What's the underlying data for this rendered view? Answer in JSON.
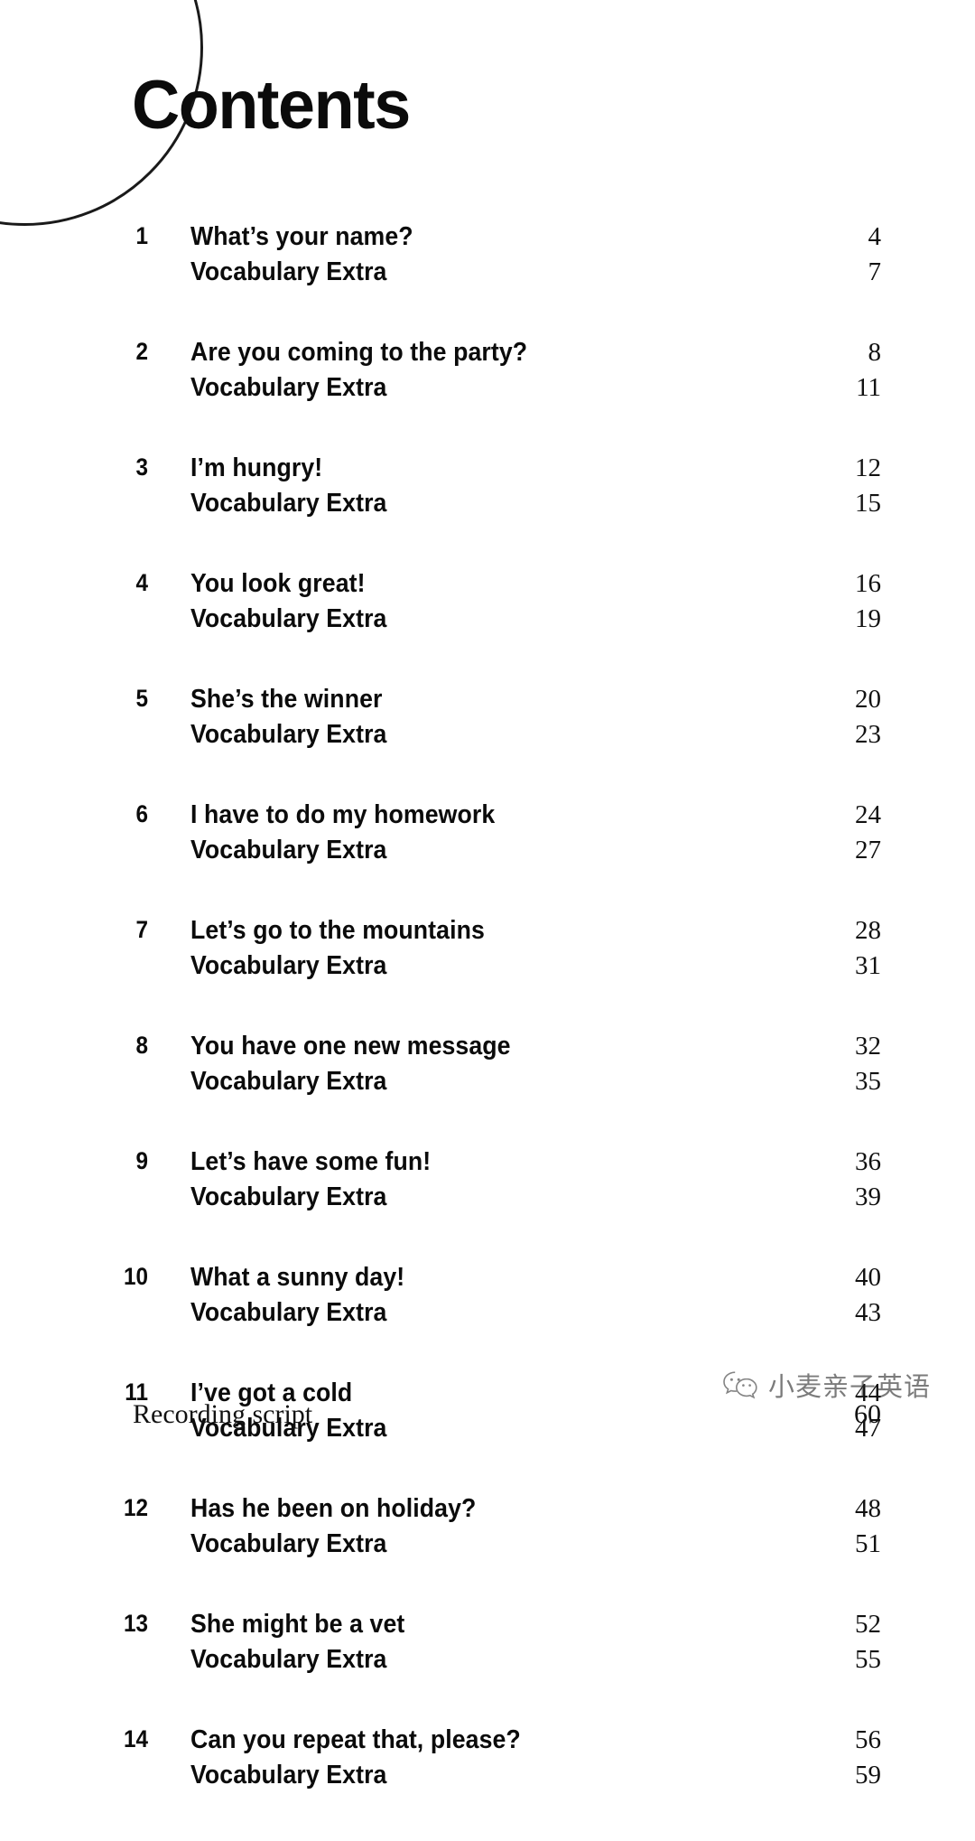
{
  "page": {
    "title": "Contents",
    "decoration": "circle-arc"
  },
  "toc": {
    "groups": [
      {
        "number": "1",
        "title": "What’s your name?",
        "page": "4",
        "sub_label": "Vocabulary Extra",
        "sub_page": "7"
      },
      {
        "number": "2",
        "title": "Are you coming to the party?",
        "page": "8",
        "sub_label": "Vocabulary Extra",
        "sub_page": "11"
      },
      {
        "number": "3",
        "title": "I’m hungry!",
        "page": "12",
        "sub_label": "Vocabulary Extra",
        "sub_page": "15"
      },
      {
        "number": "4",
        "title": "You look great!",
        "page": "16",
        "sub_label": "Vocabulary Extra",
        "sub_page": "19"
      },
      {
        "number": "5",
        "title": "She’s the winner",
        "page": "20",
        "sub_label": "Vocabulary Extra",
        "sub_page": "23"
      },
      {
        "number": "6",
        "title": "I have to do my homework",
        "page": "24",
        "sub_label": "Vocabulary Extra",
        "sub_page": "27"
      },
      {
        "number": "7",
        "title": "Let’s go to the mountains",
        "page": "28",
        "sub_label": "Vocabulary Extra",
        "sub_page": "31"
      },
      {
        "number": "8",
        "title": "You have one new message",
        "page": "32",
        "sub_label": "Vocabulary Extra",
        "sub_page": "35"
      },
      {
        "number": "9",
        "title": "Let’s have some fun!",
        "page": "36",
        "sub_label": "Vocabulary Extra",
        "sub_page": "39"
      },
      {
        "number": "10",
        "title": "What a sunny day!",
        "page": "40",
        "sub_label": "Vocabulary Extra",
        "sub_page": "43"
      },
      {
        "number": "11",
        "title": "I’ve got a cold",
        "page": "44",
        "sub_label": "Vocabulary Extra",
        "sub_page": "47"
      },
      {
        "number": "12",
        "title": "Has he been on holiday?",
        "page": "48",
        "sub_label": "Vocabulary Extra",
        "sub_page": "51"
      },
      {
        "number": "13",
        "title": "She might be a vet",
        "page": "52",
        "sub_label": "Vocabulary Extra",
        "sub_page": "55"
      },
      {
        "number": "14",
        "title": "Can you repeat that, please?",
        "page": "56",
        "sub_label": "Vocabulary Extra",
        "sub_page": "59"
      }
    ]
  },
  "footer": {
    "label": "Recording script",
    "page": "60"
  },
  "watermark": {
    "text": "小麦亲子英语",
    "icon": "wechat-speech-bubble-icon"
  },
  "colors": {
    "ink": "#0b0b0b",
    "page_number_ink": "#111111",
    "background": "#ffffff",
    "watermark": "#2b2b2b"
  }
}
